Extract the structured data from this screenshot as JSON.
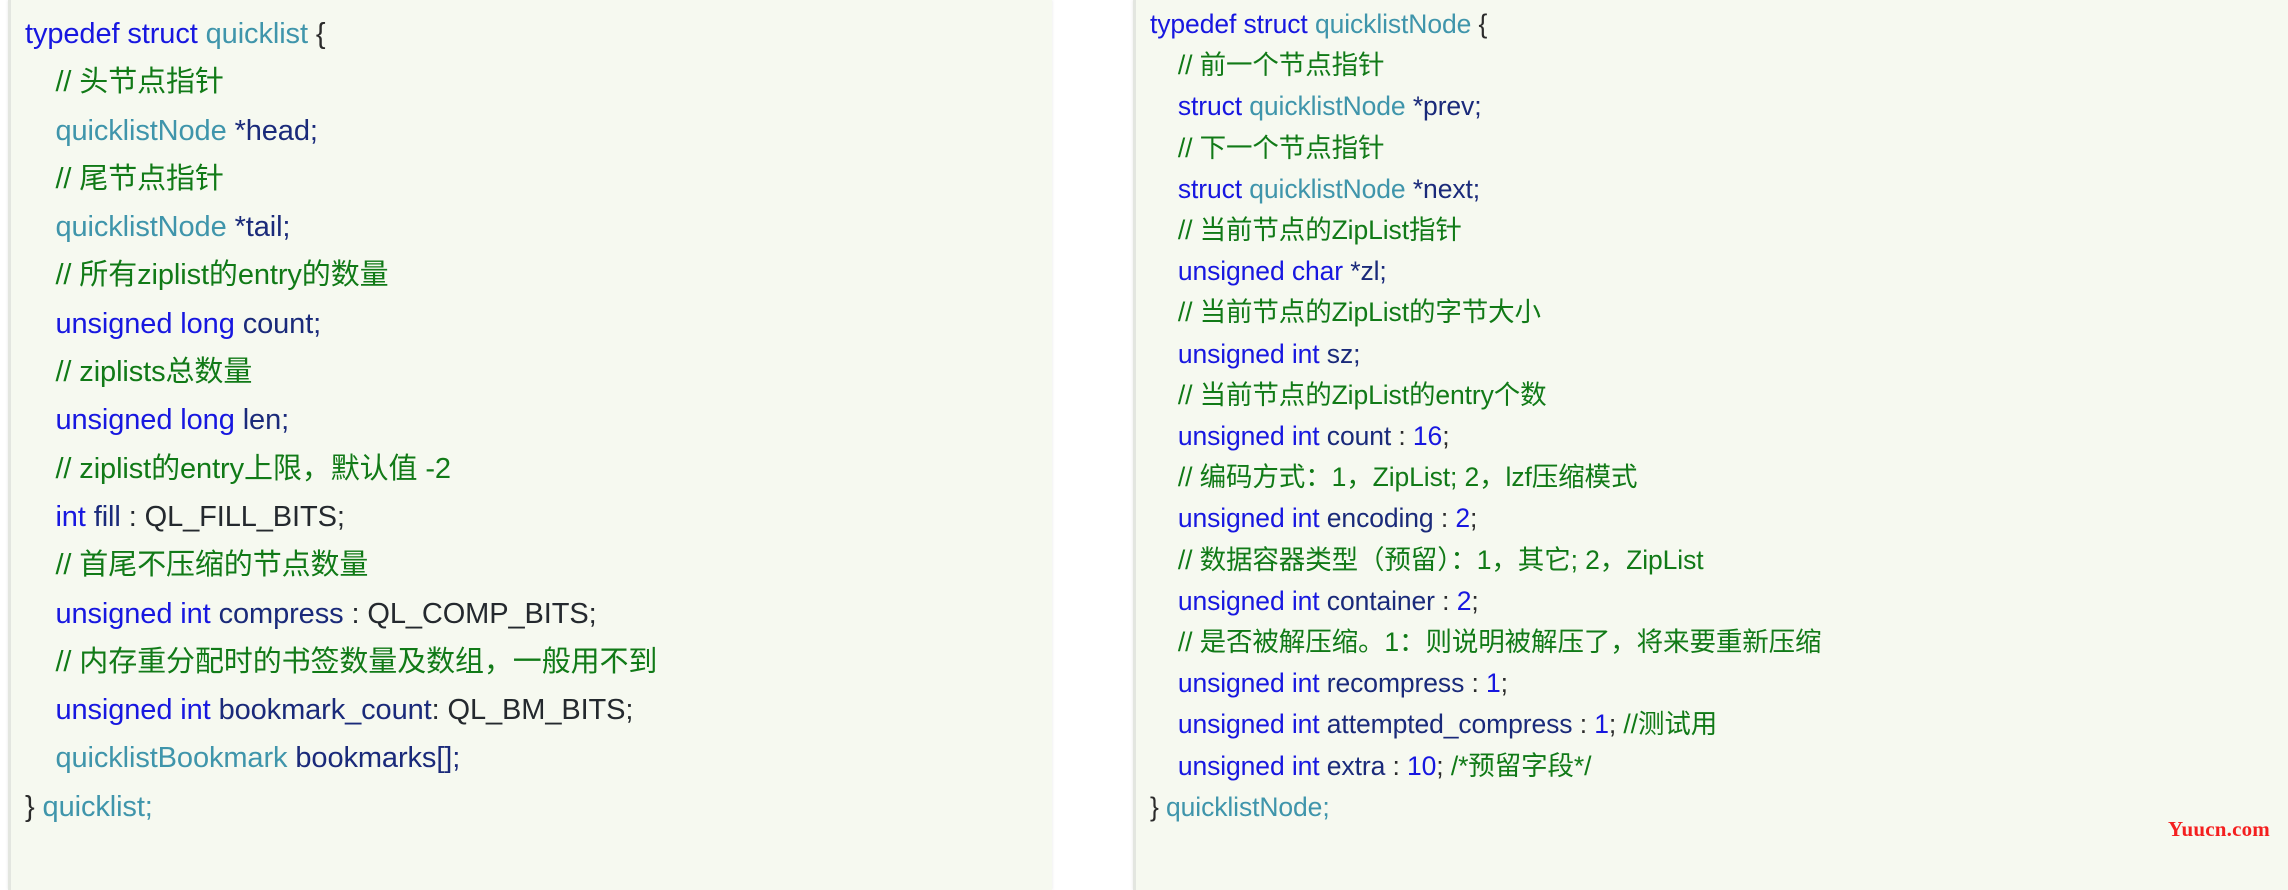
{
  "colors": {
    "background": "#ffffff",
    "panel_background": "#f6f9f0",
    "panel_border": "#e3e6e0",
    "keyword": "#1717e0",
    "type": "#3f95ab",
    "comment": "#117a17",
    "identifier": "#1a2a7a",
    "constant": "#24292e",
    "number": "#1717e0",
    "watermark": "#f41f1f"
  },
  "watermark": {
    "text": "Yuucn.com"
  },
  "panels": [
    {
      "name": "quicklist-struct",
      "lines": [
        {
          "indent": 0,
          "tokens": [
            {
              "t": "kw",
              "v": "typedef struct "
            },
            {
              "t": "typ",
              "v": "quicklist"
            },
            {
              "t": "pun",
              "v": " {"
            }
          ]
        },
        {
          "indent": 1,
          "tokens": [
            {
              "t": "cmt",
              "v": "// 头节点指针"
            }
          ]
        },
        {
          "indent": 1,
          "tokens": [
            {
              "t": "typ",
              "v": "quicklistNode"
            },
            {
              "t": "star",
              "v": " *head;"
            }
          ]
        },
        {
          "indent": 1,
          "tokens": [
            {
              "t": "cmt",
              "v": "// 尾节点指针"
            }
          ]
        },
        {
          "indent": 1,
          "tokens": [
            {
              "t": "typ",
              "v": "quicklistNode"
            },
            {
              "t": "star",
              "v": " *tail;"
            }
          ]
        },
        {
          "indent": 1,
          "tokens": [
            {
              "t": "cmt",
              "v": "// 所有ziplist的entry的数量"
            }
          ]
        },
        {
          "indent": 1,
          "tokens": [
            {
              "t": "kw",
              "v": "unsigned long "
            },
            {
              "t": "id",
              "v": "count;"
            }
          ]
        },
        {
          "indent": 1,
          "tokens": [
            {
              "t": "cmt",
              "v": "// ziplists总数量"
            }
          ]
        },
        {
          "indent": 1,
          "tokens": [
            {
              "t": "kw",
              "v": "unsigned long "
            },
            {
              "t": "id",
              "v": "len;"
            }
          ]
        },
        {
          "indent": 1,
          "tokens": [
            {
              "t": "cmt",
              "v": "// ziplist的entry上限，默认值 -2"
            }
          ]
        },
        {
          "indent": 1,
          "tokens": [
            {
              "t": "kw",
              "v": "int "
            },
            {
              "t": "id",
              "v": "fill"
            },
            {
              "t": "con",
              "v": " : QL_FILL_BITS;"
            }
          ]
        },
        {
          "indent": 1,
          "tokens": [
            {
              "t": "cmt",
              "v": "// 首尾不压缩的节点数量"
            }
          ]
        },
        {
          "indent": 1,
          "tokens": [
            {
              "t": "kw",
              "v": "unsigned int "
            },
            {
              "t": "id",
              "v": "compress"
            },
            {
              "t": "con",
              "v": " : QL_COMP_BITS;"
            }
          ]
        },
        {
          "indent": 1,
          "tokens": [
            {
              "t": "cmt",
              "v": "// 内存重分配时的书签数量及数组，一般用不到"
            }
          ]
        },
        {
          "indent": 1,
          "tokens": [
            {
              "t": "kw",
              "v": "unsigned int "
            },
            {
              "t": "id",
              "v": "bookmark_count"
            },
            {
              "t": "con",
              "v": ": QL_BM_BITS;"
            }
          ]
        },
        {
          "indent": 1,
          "tokens": [
            {
              "t": "typ",
              "v": "quicklistBookmark "
            },
            {
              "t": "id",
              "v": "bookmarks[];"
            }
          ]
        },
        {
          "indent": 0,
          "tokens": [
            {
              "t": "pun",
              "v": "} "
            },
            {
              "t": "typ",
              "v": "quicklist;"
            }
          ]
        }
      ]
    },
    {
      "name": "quicklistnode-struct",
      "lines": [
        {
          "indent": 0,
          "tokens": [
            {
              "t": "kw",
              "v": "typedef struct "
            },
            {
              "t": "typ",
              "v": "quicklistNode"
            },
            {
              "t": "pun",
              "v": " {"
            }
          ]
        },
        {
          "indent": 1,
          "tokens": [
            {
              "t": "cmt",
              "v": "// 前一个节点指针"
            }
          ]
        },
        {
          "indent": 1,
          "tokens": [
            {
              "t": "kw",
              "v": "struct "
            },
            {
              "t": "typ",
              "v": "quicklistNode"
            },
            {
              "t": "star",
              "v": " *prev;"
            }
          ]
        },
        {
          "indent": 1,
          "tokens": [
            {
              "t": "cmt",
              "v": "// 下一个节点指针"
            }
          ]
        },
        {
          "indent": 1,
          "tokens": [
            {
              "t": "kw",
              "v": "struct "
            },
            {
              "t": "typ",
              "v": "quicklistNode"
            },
            {
              "t": "star",
              "v": " *next;"
            }
          ]
        },
        {
          "indent": 1,
          "tokens": [
            {
              "t": "cmt",
              "v": "// 当前节点的ZipList指针"
            }
          ]
        },
        {
          "indent": 1,
          "tokens": [
            {
              "t": "kw",
              "v": "unsigned char "
            },
            {
              "t": "star",
              "v": "*zl;"
            }
          ]
        },
        {
          "indent": 1,
          "tokens": [
            {
              "t": "cmt",
              "v": "// 当前节点的ZipList的字节大小"
            }
          ]
        },
        {
          "indent": 1,
          "tokens": [
            {
              "t": "kw",
              "v": "unsigned int "
            },
            {
              "t": "id",
              "v": "sz;"
            }
          ]
        },
        {
          "indent": 1,
          "tokens": [
            {
              "t": "cmt",
              "v": "// 当前节点的ZipList的entry个数"
            }
          ]
        },
        {
          "indent": 1,
          "tokens": [
            {
              "t": "kw",
              "v": "unsigned int "
            },
            {
              "t": "id",
              "v": "count"
            },
            {
              "t": "pun",
              "v": " : "
            },
            {
              "t": "num",
              "v": "16"
            },
            {
              "t": "pun",
              "v": ";"
            }
          ]
        },
        {
          "indent": 1,
          "tokens": [
            {
              "t": "cmt",
              "v": "// 编码方式：1，ZipList; 2，lzf压缩模式"
            }
          ]
        },
        {
          "indent": 1,
          "tokens": [
            {
              "t": "kw",
              "v": "unsigned int "
            },
            {
              "t": "id",
              "v": "encoding"
            },
            {
              "t": "pun",
              "v": " : "
            },
            {
              "t": "num",
              "v": "2"
            },
            {
              "t": "pun",
              "v": ";"
            }
          ]
        },
        {
          "indent": 1,
          "tokens": [
            {
              "t": "cmt",
              "v": "// 数据容器类型（预留）：1，其它; 2，ZipList"
            }
          ]
        },
        {
          "indent": 1,
          "tokens": [
            {
              "t": "kw",
              "v": "unsigned int "
            },
            {
              "t": "id",
              "v": "container"
            },
            {
              "t": "pun",
              "v": " : "
            },
            {
              "t": "num",
              "v": "2"
            },
            {
              "t": "pun",
              "v": ";"
            }
          ]
        },
        {
          "indent": 1,
          "tokens": [
            {
              "t": "cmt",
              "v": "// 是否被解压缩。1：则说明被解压了，将来要重新压缩"
            }
          ]
        },
        {
          "indent": 1,
          "tokens": [
            {
              "t": "kw",
              "v": "unsigned int "
            },
            {
              "t": "id",
              "v": "recompress"
            },
            {
              "t": "pun",
              "v": " : "
            },
            {
              "t": "num",
              "v": "1"
            },
            {
              "t": "pun",
              "v": ";"
            }
          ]
        },
        {
          "indent": 1,
          "tokens": [
            {
              "t": "kw",
              "v": "unsigned int "
            },
            {
              "t": "id",
              "v": "attempted_compress"
            },
            {
              "t": "pun",
              "v": " : "
            },
            {
              "t": "num",
              "v": "1"
            },
            {
              "t": "pun",
              "v": "; "
            },
            {
              "t": "cmt",
              "v": "//测试用"
            }
          ]
        },
        {
          "indent": 1,
          "tokens": [
            {
              "t": "kw",
              "v": "unsigned int "
            },
            {
              "t": "id",
              "v": "extra"
            },
            {
              "t": "pun",
              "v": " : "
            },
            {
              "t": "num",
              "v": "10"
            },
            {
              "t": "pun",
              "v": "; "
            },
            {
              "t": "cmt",
              "v": "/*预留字段*/"
            }
          ]
        },
        {
          "indent": 0,
          "tokens": [
            {
              "t": "pun",
              "v": "} "
            },
            {
              "t": "typ",
              "v": "quicklistNode;"
            }
          ]
        }
      ]
    }
  ]
}
